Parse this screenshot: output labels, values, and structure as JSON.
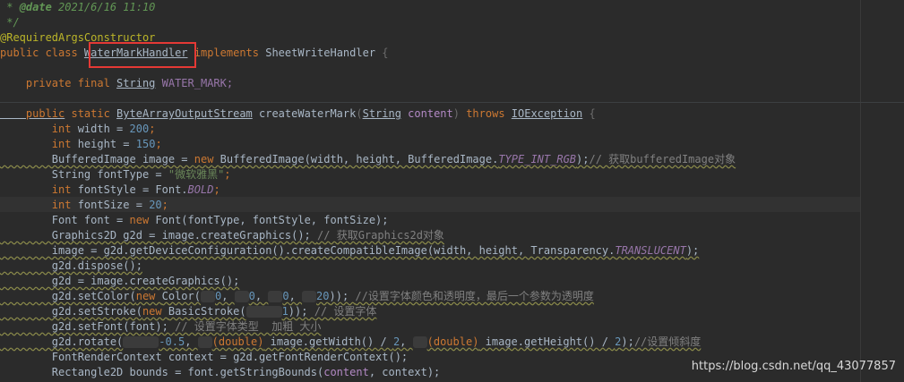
{
  "code": {
    "l0": {
      "a": " * ",
      "b": "@date",
      "c": " 2021/6/16 11:10"
    },
    "l1": " */",
    "l2": "@RequiredArgsConstructor",
    "l3": {
      "a": "public class ",
      "b": "WaterMarkHandler",
      "c": " implements ",
      "d": "SheetWriteHandler",
      "e": " {"
    },
    "l4": {
      "a": "    private final ",
      "b": "String",
      "c": " WATER_MARK;"
    },
    "l5": {
      "a": "    public",
      "b": " static ",
      "c": "ByteArrayOutputStream",
      "d": " createWaterMark",
      "e": "(",
      "f": "String",
      "g": " content",
      "h": ")",
      "i": " throws ",
      "j": "IOException",
      "k": " {"
    },
    "l6": {
      "a": "        int ",
      "b": "width",
      "c": " = ",
      "d": "200",
      "e": ";"
    },
    "l7": {
      "a": "        int ",
      "b": "height",
      "c": " = ",
      "d": "150",
      "e": ";"
    },
    "l8": {
      "a": "        BufferedImage image = ",
      "b": "new ",
      "c": "BufferedImage(width, height, BufferedImage.",
      "d": "TYPE_INT_RGB",
      "e": ");",
      "f": "// 获取bufferedImage对象"
    },
    "l9": {
      "a": "        String fontType = ",
      "b": "\"微软雅黑\"",
      "c": ";"
    },
    "l10": {
      "a": "        int ",
      "b": "fontStyle = Font.",
      "c": "BOLD",
      "d": ";"
    },
    "l11": {
      "a": "        int ",
      "b": "fontSize = ",
      "c": "20",
      "d": ";"
    },
    "l12": {
      "a": "        Font font = ",
      "b": "new ",
      "c": "Font(fontType, fontStyle, fontSize);"
    },
    "l13": {
      "a": "        Graphics2D g2d = image.createGraphics(); ",
      "b": "// 获取Graphics2d对象"
    },
    "l14": {
      "a": "        image = g2d.getDeviceConfiguration().createCompatibleImage(width, height, Transparency.",
      "b": "TRANSLUCENT",
      "c": ");"
    },
    "l15": "        g2d.dispose();",
    "l16": "        g2d = image.createGraphics();",
    "l17": {
      "a": "        g2d.setColor(",
      "b": "new ",
      "c": "Color(",
      "d": "0",
      "e": ", ",
      "f": "0",
      "g": ", ",
      "h": "0",
      "i": ", ",
      "j": "20",
      "k": ")); ",
      "l": "//设置字体颜色和透明度，最后一个参数为透明度"
    },
    "l18": {
      "a": "        g2d.setStroke(",
      "b": "new ",
      "c": "BasicStroke(",
      "d": "1",
      "e": ")); ",
      "f": "// 设置字体"
    },
    "l19": {
      "a": "        g2d.setFont(font); ",
      "b": "// 设置字体类型  加粗 大小"
    },
    "l20": {
      "a": "        g2d.rotate(",
      "b": "-0.5",
      "c": ", ",
      "d": "(double)",
      "e": " image.getWidth() / ",
      "f": "2",
      "g": ", ",
      "h": "(double)",
      "i": " image.getHeight() / ",
      "j": "2",
      "k": ");",
      "l": "//设置倾斜度"
    },
    "l21": "        FontRenderContext context = g2d.getFontRenderContext();",
    "l22": {
      "a": "        Rectangle2D bounds = font.getStringBounds(",
      "b": "content",
      "c": ", context);"
    }
  },
  "watermark": "https://blog.csdn.net/qq_43077857",
  "colors": {
    "background": "#2b2b2b",
    "highlight_box": "#e53935",
    "keyword": "#cc7832",
    "number": "#6897bb"
  }
}
